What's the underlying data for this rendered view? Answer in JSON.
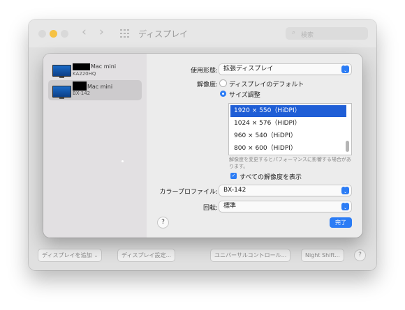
{
  "window": {
    "title": "ディスプレイ",
    "search_placeholder": "検索",
    "nav_back": "‹",
    "nav_forward": "›"
  },
  "bottom_bar": {
    "add_display": "ディスプレイを追加",
    "display_settings": "ディスプレイ設定...",
    "universal_control": "ユニバーサルコントロール...",
    "night_shift": "Night Shift...",
    "help": "?"
  },
  "sidebar": {
    "items": [
      {
        "name": "Mac mini",
        "model": "KA220HQ",
        "selected": false
      },
      {
        "name": "Mac mini",
        "model": "BX-142",
        "selected": true
      }
    ]
  },
  "settings": {
    "usage_label": "使用形態:",
    "usage_value": "拡張ディスプレイ",
    "resolution_label": "解像度:",
    "radio_default": "ディスプレイのデフォルト",
    "radio_scaled": "サイズ調整",
    "resolutions": [
      "1920 × 550（HiDPI）",
      "1024 × 576（HiDPI）",
      "960 × 540（HiDPI）",
      "800 × 600（HiDPI）"
    ],
    "note": "解像度を変更するとパフォーマンスに影響する場合があります。",
    "show_all_label": "すべての解像度を表示",
    "color_profile_label": "カラープロファイル:",
    "color_profile_value": "BX-142",
    "rotation_label": "回転:",
    "rotation_value": "標準",
    "help": "?",
    "done": "完了"
  },
  "colors": {
    "accent": "#2b7cf5",
    "selection": "#1f5ed6"
  }
}
